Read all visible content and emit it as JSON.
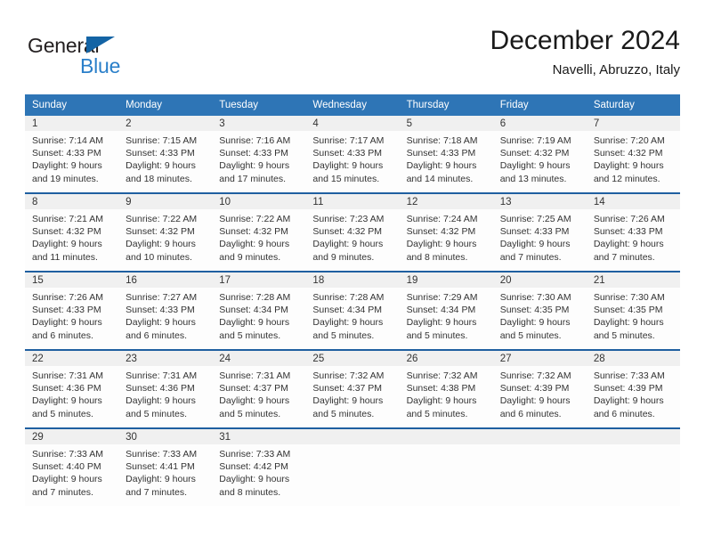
{
  "brand": {
    "name_top": "General",
    "name_bottom": "Blue",
    "flag_color": "#1464a5",
    "blue_color": "#2a7fc9"
  },
  "header": {
    "title": "December 2024",
    "subtitle": "Navelli, Abruzzo, Italy"
  },
  "theme": {
    "header_bg": "#2e75b6",
    "week_separator": "#1f5fa0",
    "daynum_bg": "#f0f0f0",
    "cell_bg": "#fdfdfd",
    "text": "#333333"
  },
  "weekdays": [
    "Sunday",
    "Monday",
    "Tuesday",
    "Wednesday",
    "Thursday",
    "Friday",
    "Saturday"
  ],
  "labels": {
    "sunrise_prefix": "Sunrise:",
    "sunset_prefix": "Sunset:",
    "daylight_prefix": "Daylight:"
  },
  "weeks": [
    [
      {
        "day": "1",
        "sunrise": "Sunrise: 7:14 AM",
        "sunset": "Sunset: 4:33 PM",
        "daylight_1": "Daylight: 9 hours",
        "daylight_2": "and 19 minutes."
      },
      {
        "day": "2",
        "sunrise": "Sunrise: 7:15 AM",
        "sunset": "Sunset: 4:33 PM",
        "daylight_1": "Daylight: 9 hours",
        "daylight_2": "and 18 minutes."
      },
      {
        "day": "3",
        "sunrise": "Sunrise: 7:16 AM",
        "sunset": "Sunset: 4:33 PM",
        "daylight_1": "Daylight: 9 hours",
        "daylight_2": "and 17 minutes."
      },
      {
        "day": "4",
        "sunrise": "Sunrise: 7:17 AM",
        "sunset": "Sunset: 4:33 PM",
        "daylight_1": "Daylight: 9 hours",
        "daylight_2": "and 15 minutes."
      },
      {
        "day": "5",
        "sunrise": "Sunrise: 7:18 AM",
        "sunset": "Sunset: 4:33 PM",
        "daylight_1": "Daylight: 9 hours",
        "daylight_2": "and 14 minutes."
      },
      {
        "day": "6",
        "sunrise": "Sunrise: 7:19 AM",
        "sunset": "Sunset: 4:32 PM",
        "daylight_1": "Daylight: 9 hours",
        "daylight_2": "and 13 minutes."
      },
      {
        "day": "7",
        "sunrise": "Sunrise: 7:20 AM",
        "sunset": "Sunset: 4:32 PM",
        "daylight_1": "Daylight: 9 hours",
        "daylight_2": "and 12 minutes."
      }
    ],
    [
      {
        "day": "8",
        "sunrise": "Sunrise: 7:21 AM",
        "sunset": "Sunset: 4:32 PM",
        "daylight_1": "Daylight: 9 hours",
        "daylight_2": "and 11 minutes."
      },
      {
        "day": "9",
        "sunrise": "Sunrise: 7:22 AM",
        "sunset": "Sunset: 4:32 PM",
        "daylight_1": "Daylight: 9 hours",
        "daylight_2": "and 10 minutes."
      },
      {
        "day": "10",
        "sunrise": "Sunrise: 7:22 AM",
        "sunset": "Sunset: 4:32 PM",
        "daylight_1": "Daylight: 9 hours",
        "daylight_2": "and 9 minutes."
      },
      {
        "day": "11",
        "sunrise": "Sunrise: 7:23 AM",
        "sunset": "Sunset: 4:32 PM",
        "daylight_1": "Daylight: 9 hours",
        "daylight_2": "and 9 minutes."
      },
      {
        "day": "12",
        "sunrise": "Sunrise: 7:24 AM",
        "sunset": "Sunset: 4:32 PM",
        "daylight_1": "Daylight: 9 hours",
        "daylight_2": "and 8 minutes."
      },
      {
        "day": "13",
        "sunrise": "Sunrise: 7:25 AM",
        "sunset": "Sunset: 4:33 PM",
        "daylight_1": "Daylight: 9 hours",
        "daylight_2": "and 7 minutes."
      },
      {
        "day": "14",
        "sunrise": "Sunrise: 7:26 AM",
        "sunset": "Sunset: 4:33 PM",
        "daylight_1": "Daylight: 9 hours",
        "daylight_2": "and 7 minutes."
      }
    ],
    [
      {
        "day": "15",
        "sunrise": "Sunrise: 7:26 AM",
        "sunset": "Sunset: 4:33 PM",
        "daylight_1": "Daylight: 9 hours",
        "daylight_2": "and 6 minutes."
      },
      {
        "day": "16",
        "sunrise": "Sunrise: 7:27 AM",
        "sunset": "Sunset: 4:33 PM",
        "daylight_1": "Daylight: 9 hours",
        "daylight_2": "and 6 minutes."
      },
      {
        "day": "17",
        "sunrise": "Sunrise: 7:28 AM",
        "sunset": "Sunset: 4:34 PM",
        "daylight_1": "Daylight: 9 hours",
        "daylight_2": "and 5 minutes."
      },
      {
        "day": "18",
        "sunrise": "Sunrise: 7:28 AM",
        "sunset": "Sunset: 4:34 PM",
        "daylight_1": "Daylight: 9 hours",
        "daylight_2": "and 5 minutes."
      },
      {
        "day": "19",
        "sunrise": "Sunrise: 7:29 AM",
        "sunset": "Sunset: 4:34 PM",
        "daylight_1": "Daylight: 9 hours",
        "daylight_2": "and 5 minutes."
      },
      {
        "day": "20",
        "sunrise": "Sunrise: 7:30 AM",
        "sunset": "Sunset: 4:35 PM",
        "daylight_1": "Daylight: 9 hours",
        "daylight_2": "and 5 minutes."
      },
      {
        "day": "21",
        "sunrise": "Sunrise: 7:30 AM",
        "sunset": "Sunset: 4:35 PM",
        "daylight_1": "Daylight: 9 hours",
        "daylight_2": "and 5 minutes."
      }
    ],
    [
      {
        "day": "22",
        "sunrise": "Sunrise: 7:31 AM",
        "sunset": "Sunset: 4:36 PM",
        "daylight_1": "Daylight: 9 hours",
        "daylight_2": "and 5 minutes."
      },
      {
        "day": "23",
        "sunrise": "Sunrise: 7:31 AM",
        "sunset": "Sunset: 4:36 PM",
        "daylight_1": "Daylight: 9 hours",
        "daylight_2": "and 5 minutes."
      },
      {
        "day": "24",
        "sunrise": "Sunrise: 7:31 AM",
        "sunset": "Sunset: 4:37 PM",
        "daylight_1": "Daylight: 9 hours",
        "daylight_2": "and 5 minutes."
      },
      {
        "day": "25",
        "sunrise": "Sunrise: 7:32 AM",
        "sunset": "Sunset: 4:37 PM",
        "daylight_1": "Daylight: 9 hours",
        "daylight_2": "and 5 minutes."
      },
      {
        "day": "26",
        "sunrise": "Sunrise: 7:32 AM",
        "sunset": "Sunset: 4:38 PM",
        "daylight_1": "Daylight: 9 hours",
        "daylight_2": "and 5 minutes."
      },
      {
        "day": "27",
        "sunrise": "Sunrise: 7:32 AM",
        "sunset": "Sunset: 4:39 PM",
        "daylight_1": "Daylight: 9 hours",
        "daylight_2": "and 6 minutes."
      },
      {
        "day": "28",
        "sunrise": "Sunrise: 7:33 AM",
        "sunset": "Sunset: 4:39 PM",
        "daylight_1": "Daylight: 9 hours",
        "daylight_2": "and 6 minutes."
      }
    ],
    [
      {
        "day": "29",
        "sunrise": "Sunrise: 7:33 AM",
        "sunset": "Sunset: 4:40 PM",
        "daylight_1": "Daylight: 9 hours",
        "daylight_2": "and 7 minutes."
      },
      {
        "day": "30",
        "sunrise": "Sunrise: 7:33 AM",
        "sunset": "Sunset: 4:41 PM",
        "daylight_1": "Daylight: 9 hours",
        "daylight_2": "and 7 minutes."
      },
      {
        "day": "31",
        "sunrise": "Sunrise: 7:33 AM",
        "sunset": "Sunset: 4:42 PM",
        "daylight_1": "Daylight: 9 hours",
        "daylight_2": "and 8 minutes."
      },
      {
        "day": "",
        "sunrise": "",
        "sunset": "",
        "daylight_1": "",
        "daylight_2": ""
      },
      {
        "day": "",
        "sunrise": "",
        "sunset": "",
        "daylight_1": "",
        "daylight_2": ""
      },
      {
        "day": "",
        "sunrise": "",
        "sunset": "",
        "daylight_1": "",
        "daylight_2": ""
      },
      {
        "day": "",
        "sunrise": "",
        "sunset": "",
        "daylight_1": "",
        "daylight_2": ""
      }
    ]
  ]
}
